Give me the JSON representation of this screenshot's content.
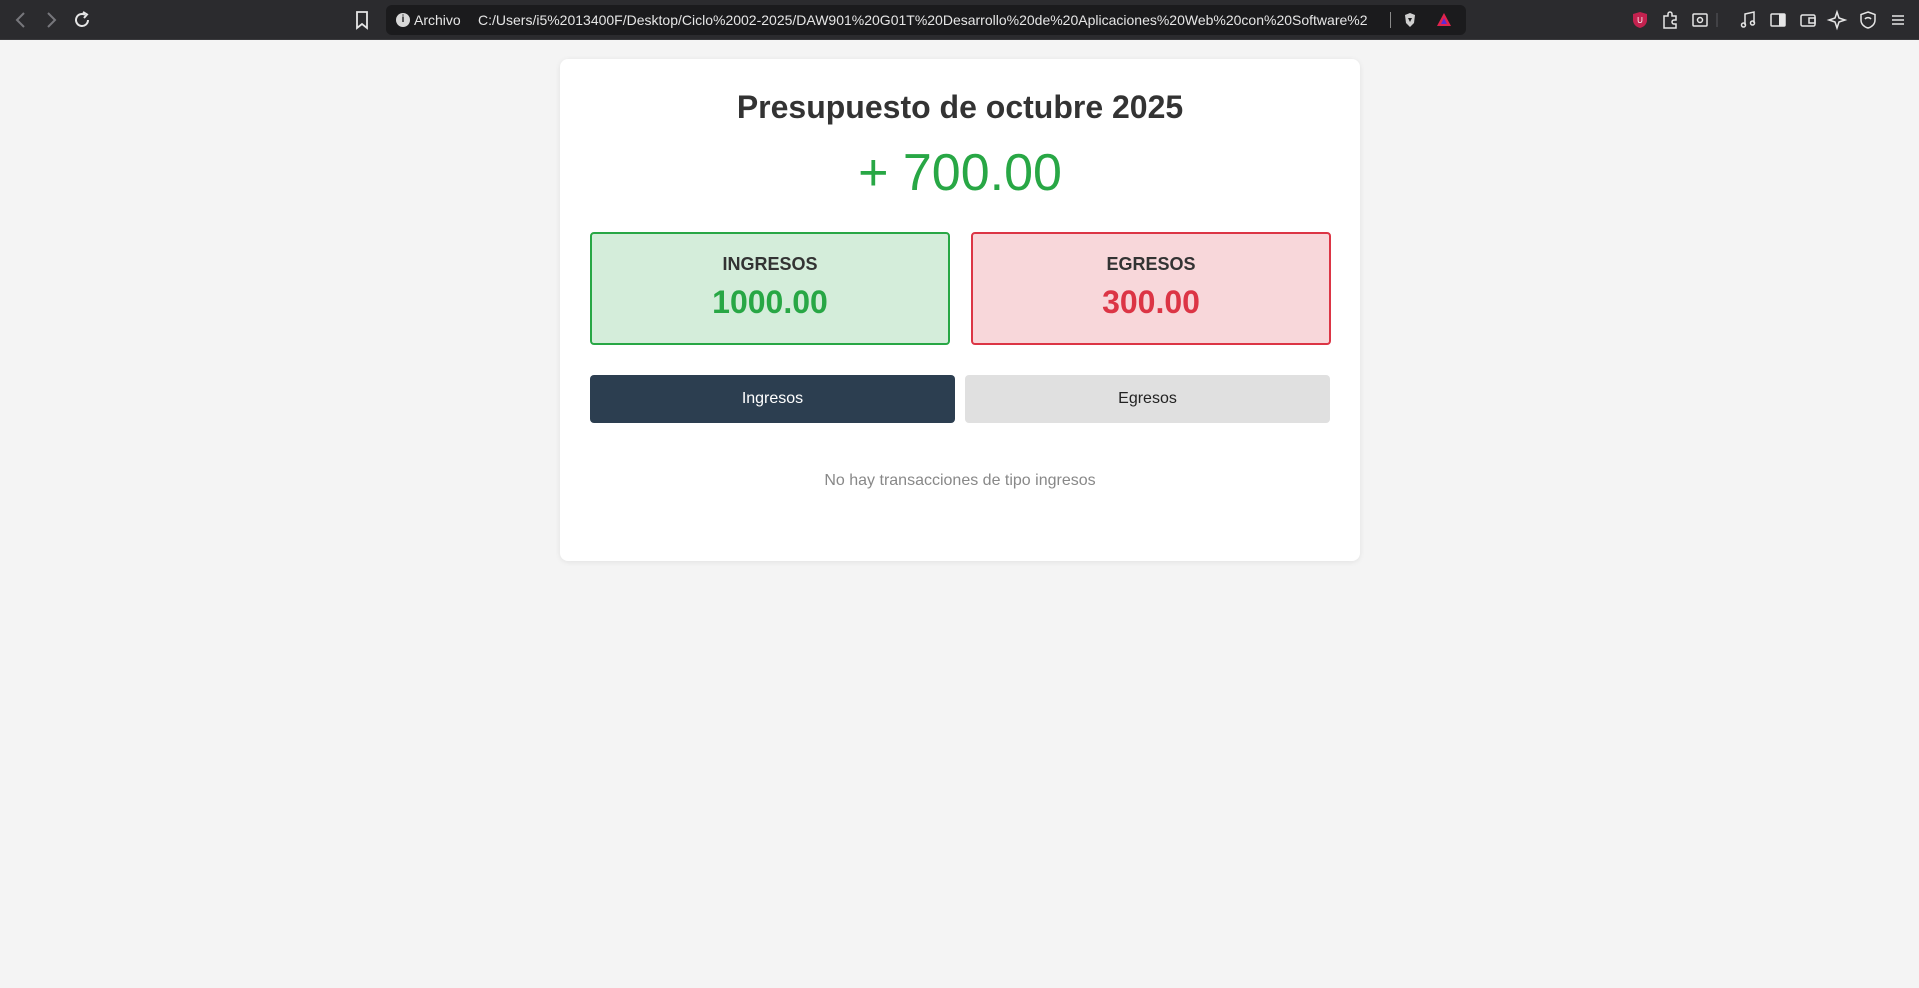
{
  "browser": {
    "back_icon": "chevron-left-icon",
    "forward_icon": "chevron-right-icon",
    "reload_icon": "reload-icon",
    "site_label": "Archivo",
    "url": "C:/Users/i5%2013400F/Desktop/Ciclo%2002-2025/DAW901%20G01T%20Desarrollo%20de%20Aplicaciones%20Web%20con%20Software%20Int..."
  },
  "budget": {
    "title": "Presupuesto de octubre 2025",
    "total": "+ 700.00",
    "income": {
      "label": "INGRESOS",
      "amount": "1000.00"
    },
    "expense": {
      "label": "EGRESOS",
      "amount": "300.00"
    }
  },
  "tabs": [
    {
      "label": "Ingresos",
      "active": true
    },
    {
      "label": "Egresos",
      "active": false
    }
  ],
  "transactions": {
    "empty_message": "No hay transacciones de tipo ingresos"
  },
  "colors": {
    "income": "#28a745",
    "expense": "#dc3545",
    "active_tab": "#2c3e50"
  }
}
